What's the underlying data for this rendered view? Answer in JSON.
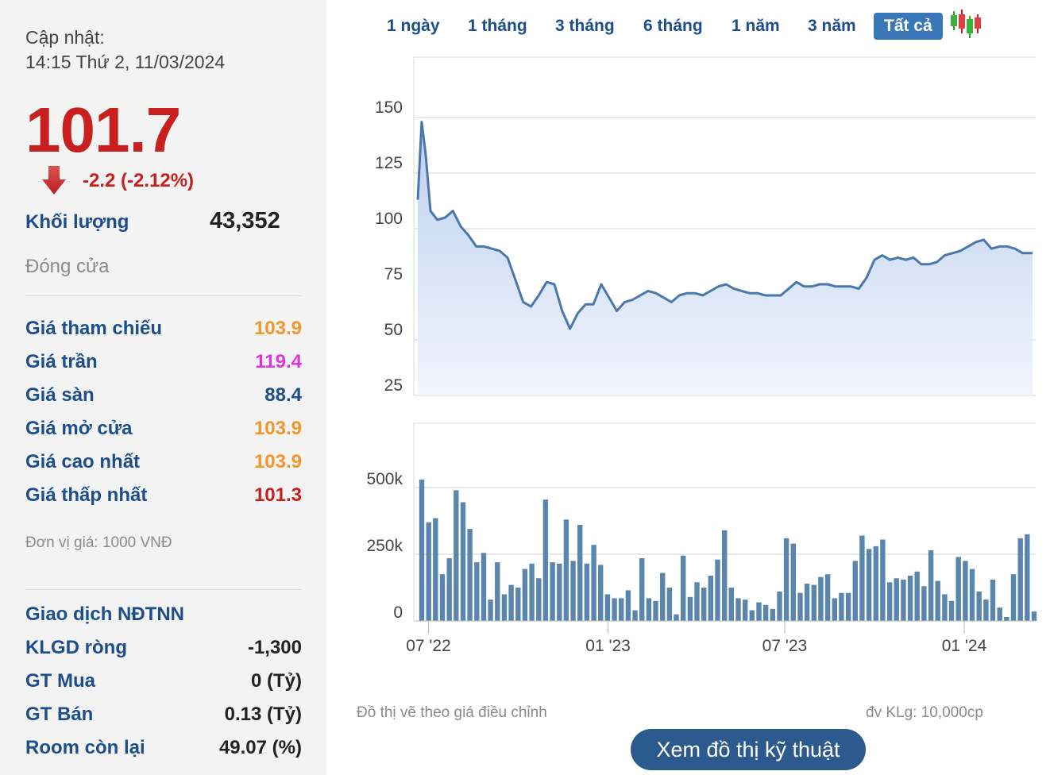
{
  "update": {
    "label": "Cập nhật:",
    "datetime": "14:15 Thứ 2, 11/03/2024"
  },
  "price": "101.7",
  "change": "-2.2 (-2.12%)",
  "volume": {
    "label": "Khối lượng",
    "value": "43,352"
  },
  "status": "Đóng cửa",
  "stats": [
    {
      "label": "Giá tham chiếu",
      "value": "103.9",
      "color": "#f0962a"
    },
    {
      "label": "Giá trần",
      "value": "119.4",
      "color": "#e231e2"
    },
    {
      "label": "Giá sàn",
      "value": "88.4",
      "color": "#1c4e8c"
    },
    {
      "label": "Giá mở cửa",
      "value": "103.9",
      "color": "#f0962a"
    },
    {
      "label": "Giá cao nhất",
      "value": "103.9",
      "color": "#f0962a"
    },
    {
      "label": "Giá thấp nhất",
      "value": "101.3",
      "color": "#c8201e"
    }
  ],
  "unit": "Đơn vị giá: 1000 VNĐ",
  "foreign": {
    "title": "Giao dịch NĐTNN",
    "rows": [
      {
        "label": "KLGD ròng",
        "value": "-1,300"
      },
      {
        "label": "GT Mua",
        "value": "0 (Tỷ)"
      },
      {
        "label": "GT Bán",
        "value": "0.13 (Tỷ)"
      },
      {
        "label": "Room còn lại",
        "value": "49.07 (%)"
      }
    ]
  },
  "tabs": [
    "1 ngày",
    "1 tháng",
    "3 tháng",
    "6 tháng",
    "1 năm",
    "3 năm",
    "Tất cả"
  ],
  "active_tab": "Tất cả",
  "notes": {
    "left": "Đồ thị vẽ theo giá điều chỉnh",
    "right": "đv KLg: 10,000cp"
  },
  "tech_button": "Xem đồ thị kỹ thuật",
  "colors": {
    "line": "#4a78aa",
    "area": "#c2d6f2",
    "bars": "#5a86ad",
    "price_red": "#c8201e",
    "label_blue": "#1c4e8c"
  },
  "chart_data": [
    {
      "type": "area",
      "ylim": [
        25,
        160
      ],
      "yticks": [
        25,
        50,
        75,
        100,
        125,
        150
      ],
      "grid": true,
      "x": [
        "2022-06-20",
        "2022-06-24",
        "2022-06-28",
        "2022-07-03",
        "2022-07-10",
        "2022-07-18",
        "2022-07-26",
        "2022-08-03",
        "2022-08-11",
        "2022-08-19",
        "2022-08-27",
        "2022-09-04",
        "2022-09-12",
        "2022-09-20",
        "2022-09-28",
        "2022-10-06",
        "2022-10-14",
        "2022-10-22",
        "2022-10-30",
        "2022-11-07",
        "2022-11-15",
        "2022-11-23",
        "2022-12-01",
        "2022-12-09",
        "2022-12-17",
        "2022-12-25",
        "2023-01-02",
        "2023-01-10",
        "2023-01-18",
        "2023-01-26",
        "2023-02-03",
        "2023-02-11",
        "2023-02-19",
        "2023-02-27",
        "2023-03-07",
        "2023-03-15",
        "2023-03-23",
        "2023-03-31",
        "2023-04-08",
        "2023-04-16",
        "2023-04-24",
        "2023-05-02",
        "2023-05-10",
        "2023-05-18",
        "2023-05-26",
        "2023-06-03",
        "2023-06-11",
        "2023-06-19",
        "2023-06-27",
        "2023-07-05",
        "2023-07-13",
        "2023-07-21",
        "2023-07-29",
        "2023-08-06",
        "2023-08-14",
        "2023-08-22",
        "2023-08-30",
        "2023-09-07",
        "2023-09-15",
        "2023-09-23",
        "2023-10-01",
        "2023-10-09",
        "2023-10-17",
        "2023-10-25",
        "2023-11-02",
        "2023-11-10",
        "2023-11-18",
        "2023-11-26",
        "2023-12-04",
        "2023-12-12",
        "2023-12-20",
        "2023-12-28",
        "2024-01-05",
        "2024-01-13",
        "2024-01-21",
        "2024-01-29",
        "2024-02-06",
        "2024-02-14",
        "2024-02-22",
        "2024-03-01",
        "2024-03-07",
        "2024-03-11"
      ],
      "values": [
        113,
        148,
        134,
        108,
        104,
        105,
        108,
        101,
        97,
        92,
        92,
        91,
        90,
        87,
        77,
        67,
        65,
        70,
        76,
        75,
        63,
        55,
        62,
        66,
        66,
        75,
        69,
        63,
        67,
        68,
        70,
        72,
        71,
        69,
        67,
        70,
        71,
        71,
        70,
        72,
        74,
        75,
        73,
        72,
        71,
        71,
        70,
        70,
        70,
        73,
        76,
        74,
        74,
        75,
        75,
        74,
        74,
        74,
        73,
        78,
        86,
        88,
        86,
        87,
        86,
        87,
        84,
        84,
        85,
        88,
        89,
        90,
        92,
        94,
        95,
        91,
        92,
        92,
        91,
        89,
        89,
        89,
        90,
        93,
        97,
        101,
        102,
        101.7
      ]
    },
    {
      "type": "bar",
      "ylim": [
        0,
        600000
      ],
      "yticks": [
        0,
        250000,
        500000
      ],
      "ytick_labels": [
        "0",
        "250k",
        "500k"
      ],
      "xtick_labels": [
        "07 '22",
        "01 '23",
        "07 '23",
        "01 '24"
      ],
      "grid": true,
      "values": [
        530000,
        370000,
        385000,
        175000,
        235000,
        490000,
        445000,
        345000,
        220000,
        255000,
        80000,
        220000,
        100000,
        135000,
        125000,
        195000,
        215000,
        160000,
        455000,
        220000,
        215000,
        380000,
        225000,
        360000,
        215000,
        285000,
        210000,
        100000,
        85000,
        85000,
        115000,
        40000,
        235000,
        85000,
        75000,
        180000,
        125000,
        25000,
        245000,
        90000,
        145000,
        125000,
        170000,
        230000,
        340000,
        125000,
        85000,
        80000,
        40000,
        70000,
        60000,
        45000,
        110000,
        310000,
        290000,
        105000,
        140000,
        135000,
        165000,
        175000,
        85000,
        105000,
        105000,
        225000,
        320000,
        270000,
        280000,
        305000,
        145000,
        160000,
        155000,
        170000,
        185000,
        130000,
        265000,
        150000,
        100000,
        75000,
        240000,
        225000,
        195000,
        110000,
        80000,
        155000,
        50000,
        15000,
        175000,
        310000,
        325000,
        35000
      ]
    }
  ]
}
